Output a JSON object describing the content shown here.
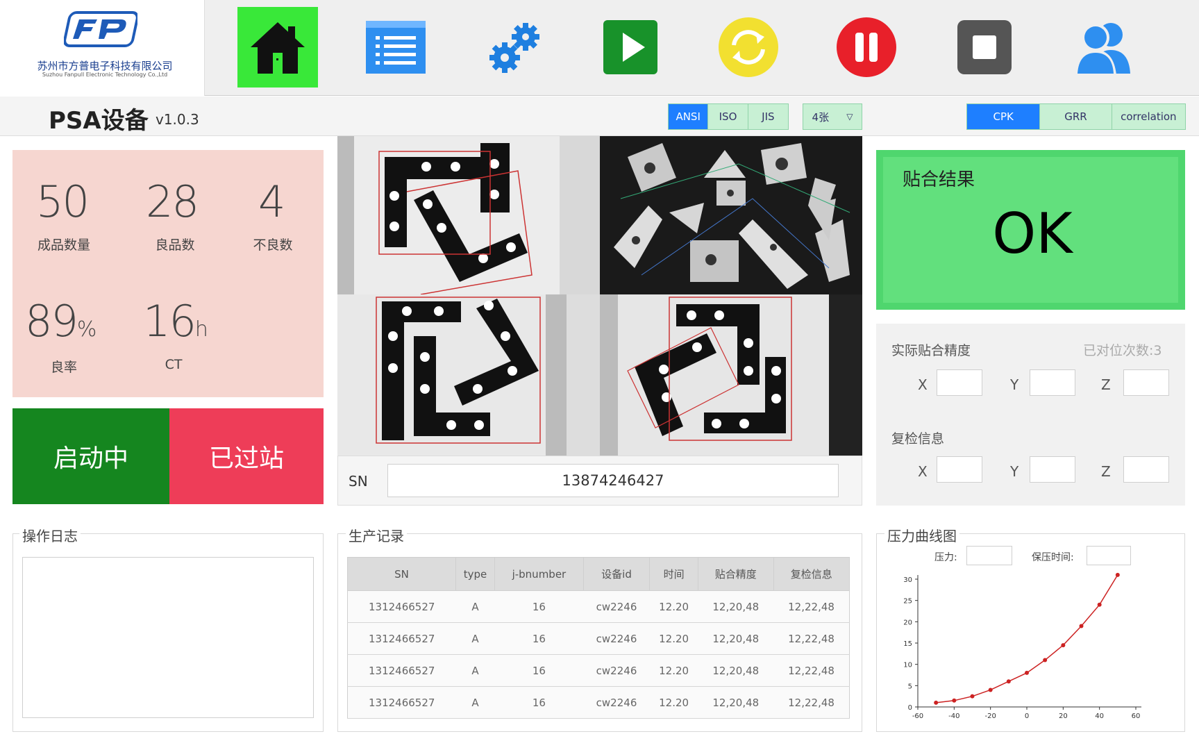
{
  "company": {
    "name_cn": "苏州市方普电子科技有限公司",
    "name_en": "Suzhou Fanpull Electronic Technology Co.,Ltd",
    "logo_text": "FP"
  },
  "toolbar": {
    "items": [
      {
        "name": "home",
        "icon": "home-icon",
        "color": "#39e839"
      },
      {
        "name": "list",
        "icon": "list-icon",
        "color": "#2e8ff0"
      },
      {
        "name": "settings",
        "icon": "gears-icon",
        "color": "#1e7fe0"
      },
      {
        "name": "run",
        "icon": "play-icon",
        "color": "#18922a"
      },
      {
        "name": "reset",
        "icon": "refresh-icon",
        "color": "#f2e030"
      },
      {
        "name": "pause",
        "icon": "pause-icon",
        "color": "#e8202a"
      },
      {
        "name": "stop",
        "icon": "stop-icon",
        "color": "#555555"
      },
      {
        "name": "users",
        "icon": "users-icon",
        "color": "#2e8ff0"
      }
    ]
  },
  "header": {
    "title": "PSA设备",
    "version": "v1.0.3"
  },
  "standard_tabs": [
    "ANSI",
    "ISO",
    "JIS"
  ],
  "standard_selected": "ANSI",
  "image_count_select": "4张",
  "analysis_tabs": [
    "CPK",
    "GRR",
    "correlation"
  ],
  "analysis_selected": "CPK",
  "stats": {
    "finished": {
      "value": "50",
      "label": "成品数量"
    },
    "good": {
      "value": "28",
      "label": "良品数"
    },
    "bad": {
      "value": "4",
      "label": "不良数"
    },
    "yield": {
      "value": "89",
      "unit": "%",
      "label": "良率"
    },
    "ct": {
      "value": "16",
      "unit": "h",
      "label": "CT"
    }
  },
  "status_buttons": {
    "running": "启动中",
    "passed": "已过站"
  },
  "sn": {
    "label": "SN",
    "value": "13874246427"
  },
  "result": {
    "title": "贴合结果",
    "value": "OK"
  },
  "precision": {
    "title": "实际贴合精度",
    "align_count": "已对位次数:3",
    "recheck_title": "复检信息",
    "axes": [
      "X",
      "Y",
      "Z"
    ]
  },
  "log": {
    "title": "操作日志"
  },
  "production": {
    "title": "生产记录",
    "columns": [
      "SN",
      "type",
      "j-bnumber",
      "设备id",
      "时间",
      "贴合精度",
      "复检信息"
    ],
    "rows": [
      [
        "1312466527",
        "A",
        "16",
        "cw2246",
        "12.20",
        "12,20,48",
        "12,22,48"
      ],
      [
        "1312466527",
        "A",
        "16",
        "cw2246",
        "12.20",
        "12,20,48",
        "12,22,48"
      ],
      [
        "1312466527",
        "A",
        "16",
        "cw2246",
        "12.20",
        "12,20,48",
        "12,22,48"
      ],
      [
        "1312466527",
        "A",
        "16",
        "cw2246",
        "12.20",
        "12,20,48",
        "12,22,48"
      ]
    ]
  },
  "pressure": {
    "title": "压力曲线图",
    "pressure_label": "压力:",
    "hold_label": "保压时间:"
  },
  "chart_data": {
    "type": "line",
    "title": "",
    "xlabel": "",
    "ylabel": "",
    "x": [
      -50,
      -40,
      -30,
      -20,
      -10,
      0,
      10,
      20,
      30,
      40,
      50
    ],
    "series": [
      {
        "values": [
          1,
          1.5,
          2.5,
          4,
          6,
          8,
          11,
          14.5,
          19,
          24,
          31
        ]
      }
    ],
    "xlim": [
      -60,
      60
    ],
    "ylim": [
      0,
      30
    ],
    "xticks": [
      -60,
      -40,
      -20,
      0,
      20,
      40,
      60
    ],
    "yticks": [
      0,
      5,
      10,
      15,
      20,
      25,
      30
    ],
    "color": "#cc2222",
    "grid": false
  }
}
